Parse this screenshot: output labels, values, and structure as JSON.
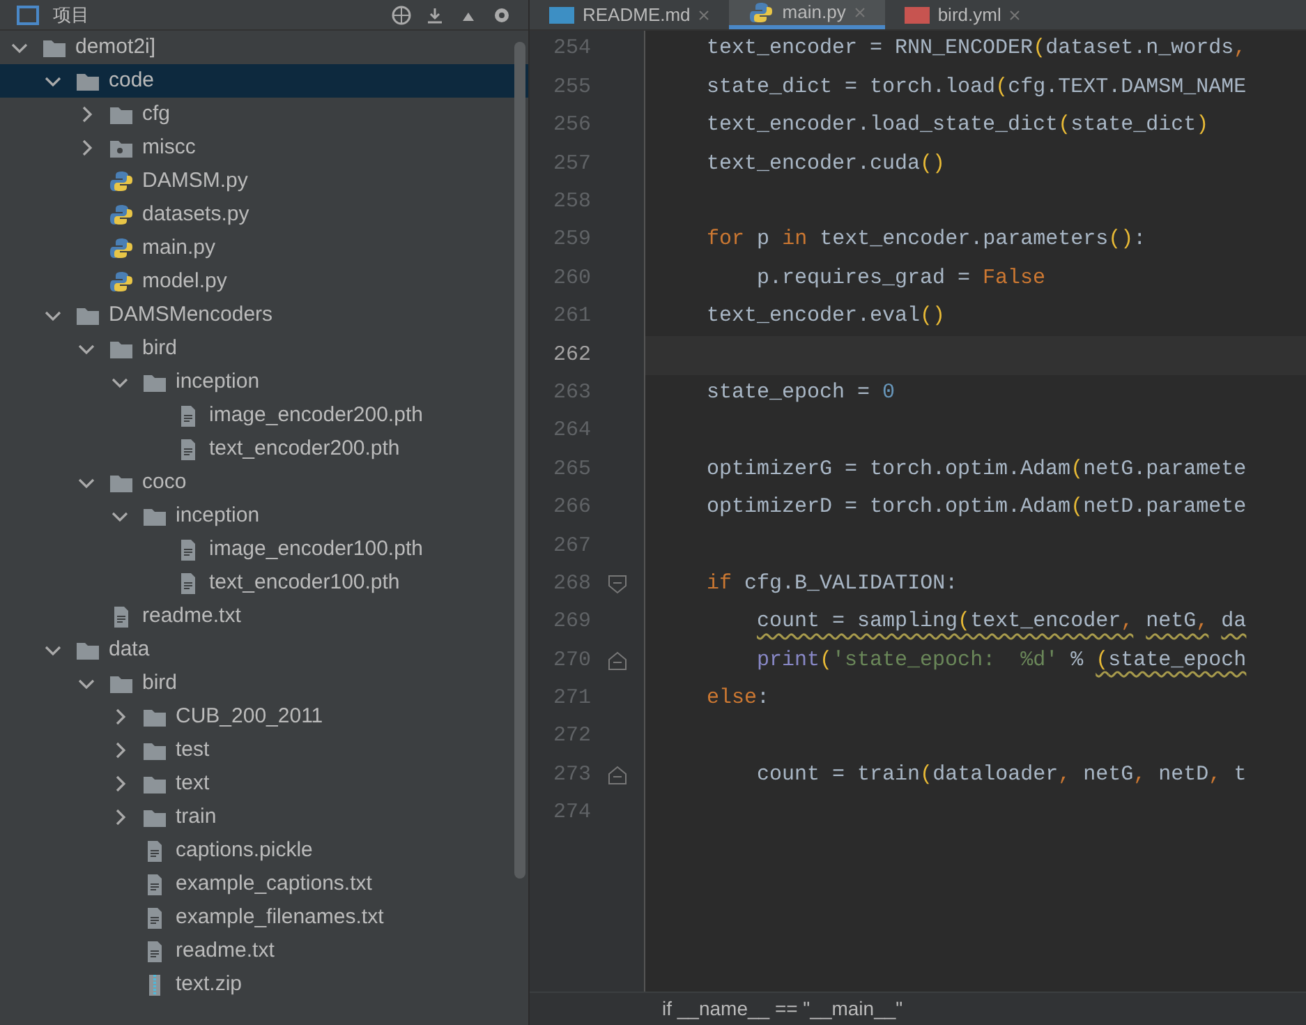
{
  "project_panel": {
    "title": "项目",
    "root": {
      "label": "demot2i]",
      "kind": "folder",
      "expanded": true,
      "selected": false,
      "children": [
        {
          "label": "code",
          "kind": "folder",
          "expanded": true,
          "selected": true,
          "children": [
            {
              "label": "cfg",
              "kind": "folder",
              "expanded": false,
              "selected": false
            },
            {
              "label": "miscc",
              "kind": "package",
              "expanded": false,
              "selected": false
            },
            {
              "label": "DAMSM.py",
              "kind": "python",
              "selected": false
            },
            {
              "label": "datasets.py",
              "kind": "python",
              "selected": false
            },
            {
              "label": "main.py",
              "kind": "python",
              "selected": false
            },
            {
              "label": "model.py",
              "kind": "python",
              "selected": false
            }
          ]
        },
        {
          "label": "DAMSMencoders",
          "kind": "folder",
          "expanded": true,
          "selected": false,
          "children": [
            {
              "label": "bird",
              "kind": "folder",
              "expanded": true,
              "selected": false,
              "children": [
                {
                  "label": "inception",
                  "kind": "folder",
                  "expanded": true,
                  "selected": false,
                  "children": [
                    {
                      "label": "image_encoder200.pth",
                      "kind": "file",
                      "selected": false
                    },
                    {
                      "label": "text_encoder200.pth",
                      "kind": "file",
                      "selected": false
                    }
                  ]
                }
              ]
            },
            {
              "label": "coco",
              "kind": "folder",
              "expanded": true,
              "selected": false,
              "children": [
                {
                  "label": "inception",
                  "kind": "folder",
                  "expanded": true,
                  "selected": false,
                  "children": [
                    {
                      "label": "image_encoder100.pth",
                      "kind": "file",
                      "selected": false
                    },
                    {
                      "label": "text_encoder100.pth",
                      "kind": "file",
                      "selected": false
                    }
                  ]
                }
              ]
            },
            {
              "label": "readme.txt",
              "kind": "file",
              "selected": false
            }
          ]
        },
        {
          "label": "data",
          "kind": "folder",
          "expanded": true,
          "selected": false,
          "children": [
            {
              "label": "bird",
              "kind": "folder",
              "expanded": true,
              "selected": false,
              "children": [
                {
                  "label": "CUB_200_2011",
                  "kind": "folder",
                  "expanded": false,
                  "selected": false
                },
                {
                  "label": "test",
                  "kind": "folder",
                  "expanded": false,
                  "selected": false
                },
                {
                  "label": "text",
                  "kind": "folder",
                  "expanded": false,
                  "selected": false
                },
                {
                  "label": "train",
                  "kind": "folder",
                  "expanded": false,
                  "selected": false
                },
                {
                  "label": "captions.pickle",
                  "kind": "file",
                  "selected": false
                },
                {
                  "label": "example_captions.txt",
                  "kind": "file",
                  "selected": false
                },
                {
                  "label": "example_filenames.txt",
                  "kind": "file",
                  "selected": false
                },
                {
                  "label": "readme.txt",
                  "kind": "file",
                  "selected": false
                },
                {
                  "label": "text.zip",
                  "kind": "zip",
                  "selected": false
                }
              ]
            }
          ]
        }
      ]
    }
  },
  "tabs": [
    {
      "label": "README.md",
      "kind": "md",
      "selected": false
    },
    {
      "label": "main.py",
      "kind": "python",
      "selected": true
    },
    {
      "label": "bird.yml",
      "kind": "yml",
      "selected": false
    }
  ],
  "editor": {
    "lines": [
      {
        "number": "254",
        "current": false,
        "tokens": [
          {
            "kind": "plain",
            "text": "    text_encoder = RNN_ENCODER"
          },
          {
            "kind": "paren",
            "text": "("
          },
          {
            "kind": "plain",
            "text": "dataset.n_words"
          },
          {
            "kind": "comma",
            "text": ","
          }
        ]
      },
      {
        "number": "255",
        "current": false,
        "tokens": [
          {
            "kind": "plain",
            "text": "    state_dict = torch.load"
          },
          {
            "kind": "paren",
            "text": "("
          },
          {
            "kind": "plain",
            "text": "cfg.TEXT.DAMSM_NAME"
          }
        ]
      },
      {
        "number": "256",
        "current": false,
        "tokens": [
          {
            "kind": "plain",
            "text": "    text_encoder.load_state_dict"
          },
          {
            "kind": "paren",
            "text": "("
          },
          {
            "kind": "plain",
            "text": "state_dict"
          },
          {
            "kind": "paren",
            "text": ")"
          }
        ]
      },
      {
        "number": "257",
        "current": false,
        "tokens": [
          {
            "kind": "plain",
            "text": "    text_encoder.cuda"
          },
          {
            "kind": "paren",
            "text": "()"
          }
        ]
      },
      {
        "number": "258",
        "current": false
      },
      {
        "number": "259",
        "current": false,
        "tokens": [
          {
            "kind": "kw",
            "text": "    for"
          },
          {
            "kind": "plain",
            "text": " p "
          },
          {
            "kind": "kw",
            "text": "in"
          },
          {
            "kind": "plain",
            "text": " text_encoder.parameters"
          },
          {
            "kind": "paren",
            "text": "()"
          },
          {
            "kind": "plain",
            "text": ":"
          }
        ]
      },
      {
        "number": "260",
        "current": false,
        "tokens": [
          {
            "kind": "plain",
            "text": "        p.requires_grad = "
          },
          {
            "kind": "kw",
            "text": "False"
          }
        ]
      },
      {
        "number": "261",
        "current": false,
        "tokens": [
          {
            "kind": "plain",
            "text": "    text_encoder.eval"
          },
          {
            "kind": "paren",
            "text": "()"
          }
        ]
      },
      {
        "number": "262",
        "current": true
      },
      {
        "number": "263",
        "current": false,
        "tokens": [
          {
            "kind": "plain",
            "text": "    state_epoch = "
          },
          {
            "kind": "num",
            "text": "0"
          }
        ]
      },
      {
        "number": "264",
        "current": false
      },
      {
        "number": "265",
        "current": false,
        "tokens": [
          {
            "kind": "plain",
            "text": "    optimizerG = torch.optim.Adam"
          },
          {
            "kind": "paren",
            "text": "("
          },
          {
            "kind": "plain",
            "text": "netG.paramete"
          }
        ]
      },
      {
        "number": "266",
        "current": false,
        "tokens": [
          {
            "kind": "plain",
            "text": "    optimizerD = torch.optim.Adam"
          },
          {
            "kind": "paren",
            "text": "("
          },
          {
            "kind": "plain",
            "text": "netD.paramete"
          }
        ]
      },
      {
        "number": "267",
        "current": false
      },
      {
        "number": "268",
        "current": false,
        "fold": {
          "kind": "start"
        },
        "tokens": [
          {
            "kind": "kw",
            "text": "    if"
          },
          {
            "kind": "plain",
            "text": " cfg.B_VALIDATION:"
          }
        ]
      },
      {
        "number": "269",
        "current": false,
        "tokens": [
          {
            "kind": "warn",
            "text": "        count = sampling"
          },
          {
            "kind": "warnparen",
            "text": "("
          },
          {
            "kind": "warn",
            "text": "text_encoder"
          },
          {
            "kind": "warncomma",
            "text": ","
          },
          {
            "kind": "warn",
            "text": " netG"
          },
          {
            "kind": "warncomma",
            "text": ","
          },
          {
            "kind": "warn",
            "text": " da"
          }
        ]
      },
      {
        "number": "270",
        "current": false,
        "fold": {
          "kind": "end"
        },
        "tokens": [
          {
            "kind": "fn",
            "text": "        print"
          },
          {
            "kind": "paren",
            "text": "("
          },
          {
            "kind": "str",
            "text": "'state_epoch:  %d'"
          },
          {
            "kind": "plain",
            "text": " % "
          },
          {
            "kind": "warnparen",
            "text": "("
          },
          {
            "kind": "warn",
            "text": "state_epoch"
          }
        ]
      },
      {
        "number": "271",
        "current": false,
        "tokens": [
          {
            "kind": "kw",
            "text": "    else"
          },
          {
            "kind": "plain",
            "text": ":"
          }
        ]
      },
      {
        "number": "272",
        "current": false
      },
      {
        "number": "273",
        "current": false,
        "fold": {
          "kind": "end"
        },
        "tokens": [
          {
            "kind": "plain",
            "text": "        count = train"
          },
          {
            "kind": "paren",
            "text": "("
          },
          {
            "kind": "plain",
            "text": "dataloader"
          },
          {
            "kind": "comma",
            "text": ","
          },
          {
            "kind": "plain",
            "text": " netG"
          },
          {
            "kind": "comma",
            "text": ","
          },
          {
            "kind": "plain",
            "text": " netD"
          },
          {
            "kind": "comma",
            "text": ","
          },
          {
            "kind": "plain",
            "text": " t"
          }
        ]
      },
      {
        "number": "274",
        "current": false
      }
    ]
  },
  "breadcrumb": "if __name__ == \"__main__\""
}
